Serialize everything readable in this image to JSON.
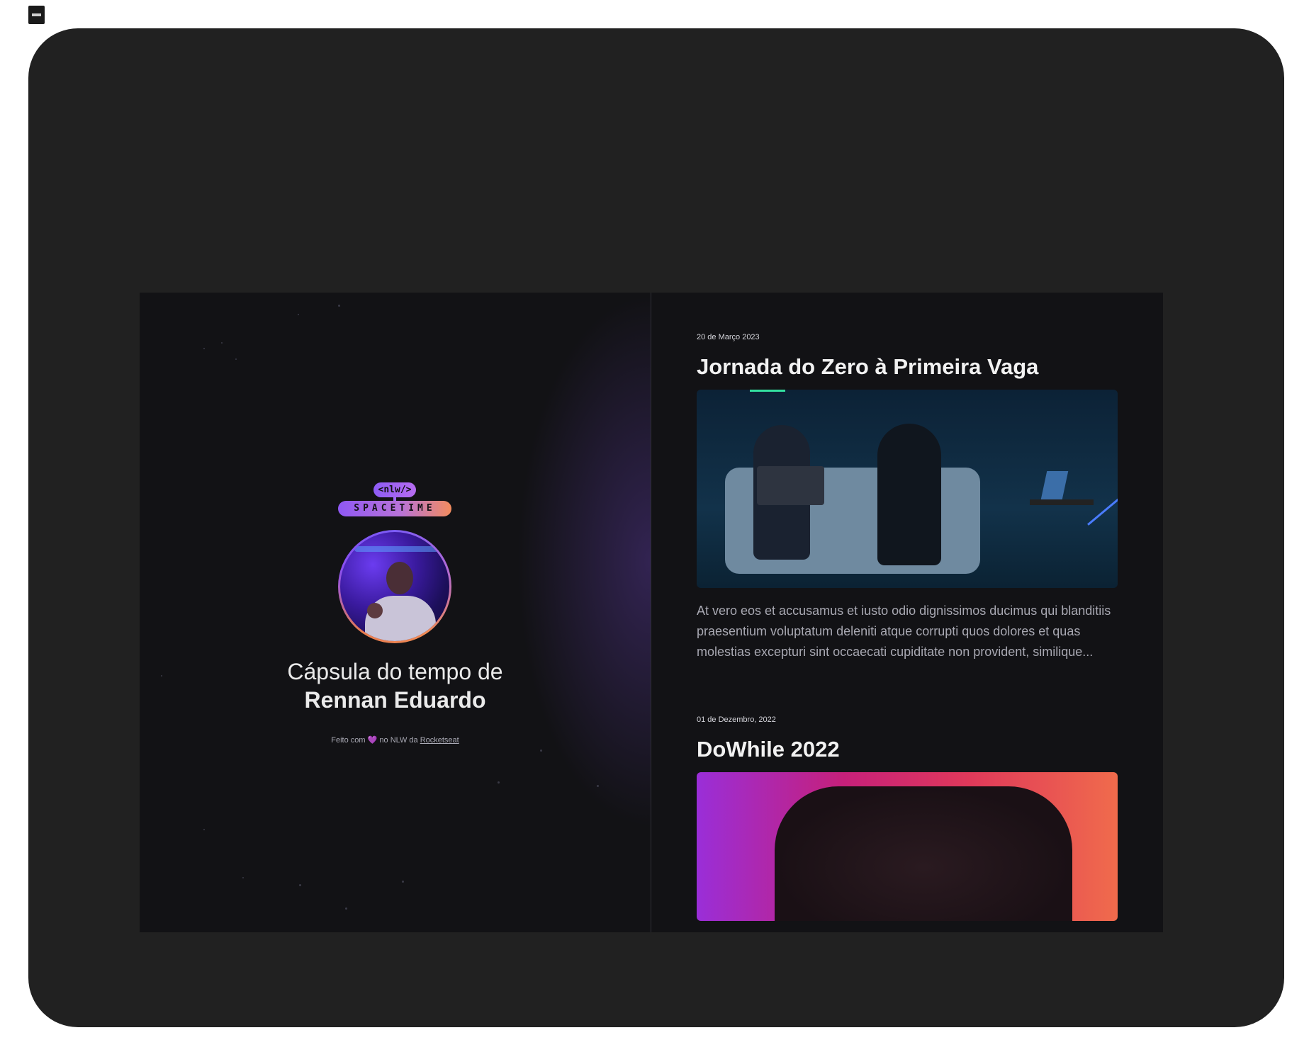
{
  "brand": {
    "tag": "<nlw/>",
    "name": "SPACETIME"
  },
  "profile": {
    "title_line1": "Cápsula do tempo de",
    "title_line2": "Rennan Eduardo"
  },
  "footer": {
    "prefix": "Feito com",
    "heart": "💜",
    "middle": "no NLW da",
    "link": "Rocketseat"
  },
  "memories": [
    {
      "date": "20 de Março 2023",
      "title": "Jornada do Zero à Primeira Vaga",
      "excerpt": "At vero eos et accusamus et iusto odio dignissimos ducimus qui blanditiis praesentium voluptatum deleniti atque corrupti quos dolores et quas molestias excepturi sint occaecati cupiditate non provident, similique..."
    },
    {
      "date": "01 de Dezembro, 2022",
      "title": "DoWhile 2022"
    }
  ],
  "colors": {
    "frame": "#212121",
    "app_bg": "#121215",
    "accent_purple": "#9e5cf6",
    "accent_orange": "#f28c5e"
  }
}
